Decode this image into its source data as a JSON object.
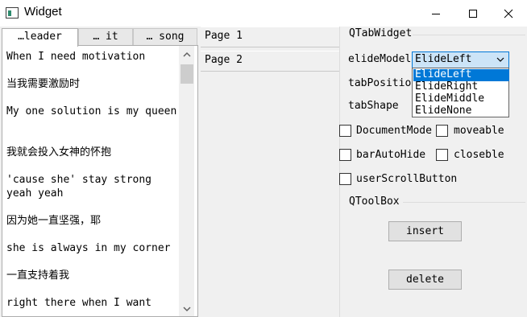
{
  "window": {
    "title": "Widget",
    "icon": "window-app-icon",
    "controls": [
      "minimize-icon",
      "maximize-icon",
      "close-icon"
    ]
  },
  "tabs": [
    {
      "label": "…leader",
      "active": true
    },
    {
      "label": "… it",
      "active": false
    },
    {
      "label": "… song",
      "active": false
    }
  ],
  "text_lines": [
    "When I need motivation",
    "当我需要激励时",
    "My one solution is my queen",
    "我就会投入女神的怀抱",
    "'cause she' stay strong yeah yeah",
    "因为她一直坚强，耶",
    "she is always in my corner",
    "一直支持着我",
    "right there when I want"
  ],
  "toolbox_pages": [
    "Page 1",
    "Page 2"
  ],
  "tab_widget_group": {
    "title": "QTabWidget",
    "elide_mode_label": "elideModel",
    "tab_position_label": "tabPositio",
    "tab_shape_label": "tabShape",
    "elide_mode_value": "ElideLeft",
    "elide_mode_options": [
      "ElideLeft",
      "ElideRight",
      "ElideMiddle",
      "ElideNone"
    ],
    "checkboxes": {
      "document_mode": {
        "label": "DocumentMode",
        "checked": false
      },
      "moveable": {
        "label": "moveable",
        "checked": false
      },
      "bar_auto_hide": {
        "label": "barAutoHide",
        "checked": false
      },
      "closeble": {
        "label": "closeble",
        "checked": false
      },
      "user_scroll_button": {
        "label": "userScrollButton",
        "checked": false
      }
    }
  },
  "toolbox_group": {
    "title": "QToolBox",
    "insert_label": "insert",
    "delete_label": "delete"
  },
  "colors": {
    "accent": "#0078d7",
    "combo_bg": "#cce4f7",
    "window_bg": "#f0f0f0"
  }
}
